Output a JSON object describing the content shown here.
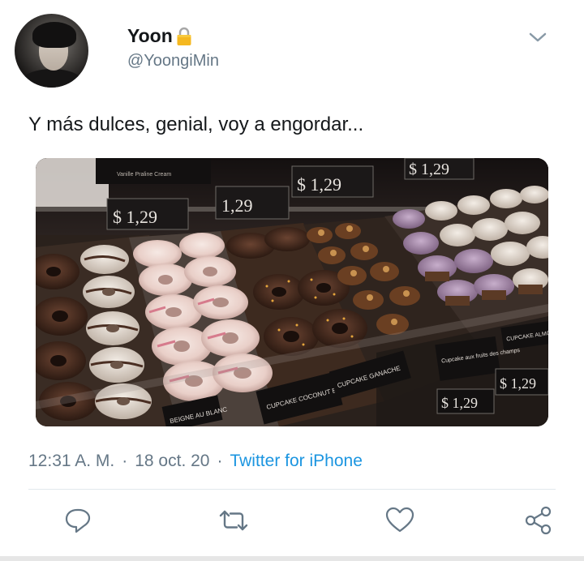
{
  "tweet": {
    "author_name": "Yoon",
    "handle": "@YoongiMin",
    "text": "Y más dulces,  genial, voy a engordar...",
    "time": "12:31 A. M.",
    "date": "18 oct. 20",
    "source": "Twitter for iPhone",
    "separator": "·"
  },
  "media": {
    "price_tags": [
      "$ 1,29",
      "1,29",
      "$ 1,29",
      "$ 1,29",
      "$ 1,29",
      "$ 1,29"
    ],
    "labels": [
      "CUPCAKE GANACHE",
      "CUPCAKE COCONUT BLEU",
      "BEIGNE AU BLANC",
      "Cupcake aux fruits des champs",
      "CUPCAKE ALMOND"
    ]
  },
  "icons": {
    "lock": "lock-icon",
    "chevron": "chevron-down-icon",
    "reply": "reply-icon",
    "retweet": "retweet-icon",
    "like": "heart-icon",
    "share": "share-icon"
  },
  "colors": {
    "accent": "#1b95e0",
    "secondary_text": "#657786",
    "icon": "#657786"
  }
}
